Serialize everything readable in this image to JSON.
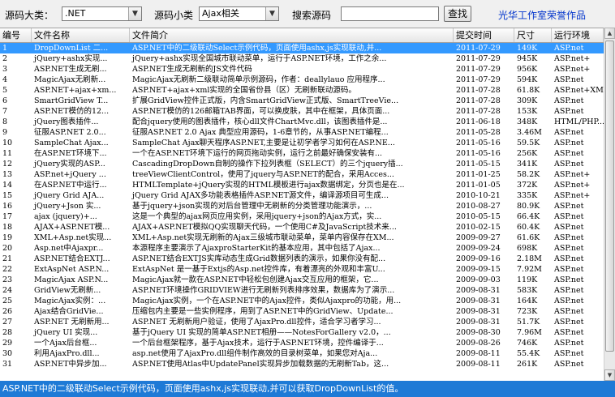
{
  "toolbar": {
    "category_label": "源码大类：",
    "category_value": ".NET",
    "subcategory_label": "源码小类",
    "subcategory_value": "Ajax相关",
    "search_label": "搜索源码",
    "search_value": "",
    "search_button": "查找",
    "credit": "光华工作室荣誉作品"
  },
  "table": {
    "columns": [
      "编号",
      "文件名称",
      "文件简介",
      "提交时间",
      "尺寸",
      "运行环境"
    ],
    "selected_row": 0,
    "rows": [
      [
        "1",
        "DropDownList 二...",
        "ASP.NET中的二级联动Select示例代码，页面使用ashx,js实现联动,并...",
        "2011-07-29",
        "149K",
        "ASP.net"
      ],
      [
        "2",
        "jQuery+ashx实现...",
        "jQuery+ashx实现全国城市联动菜单，运行于ASP.NET环境，工作之余...",
        "2011-07-29",
        "945K",
        "ASP.net+"
      ],
      [
        "3",
        "ASP.NET生成无刷...",
        "ASP.NET生成无刷新的JS文件代码",
        "2011-07-29",
        "956K",
        "ASP.net+"
      ],
      [
        "4",
        "MagicAjax无刷新...",
        "MagicAjax无刷新二级联动简单示例源码，作者：deallylauo 应用程序...",
        "2011-07-29",
        "594K",
        "ASP.net"
      ],
      [
        "5",
        "ASP.NET+ajax+xm...",
        "ASP.NET+ajax+xml实现的全国省份县（区）无刷新联动源码。",
        "2011-07-28",
        "61.8K",
        "ASP.net+XM"
      ],
      [
        "6",
        "SmartGridView T...",
        "扩展GridView控件正式版，内含SmartGridView正式版、SmartTreeVie...",
        "2011-07-28",
        "309K",
        "ASP.net"
      ],
      [
        "7",
        "ASP.NET模仿的12...",
        "ASP.NET模仿的126邮箱TAB界面，可以换皮肤，其中在框架，具体页面...",
        "2011-07-28",
        "153K",
        "ASP.net"
      ],
      [
        "8",
        "jQuery图表插件...",
        "配合jquery使用的图表插件，核心dll文件ChartMvc.dll，该图表插件是...",
        "2011-06-18",
        "348K",
        "HTML/PHP..."
      ],
      [
        "9",
        "征服ASP.NET 2.0...",
        "征服ASP.NET 2.0 Ajax 典型应用源码，1-6章节的，从事ASP.NET编程...",
        "2011-05-28",
        "3.46M",
        "ASP.net"
      ],
      [
        "10",
        "SampleChat Ajax...",
        "SampleChat Ajax聊天程序ASP.NET,主要是让初学者学习如何在ASP.NE...",
        "2011-05-16",
        "59.5K",
        "ASP.net"
      ],
      [
        "11",
        "在ASP.NET环境下...",
        "一个在ASP.NET环境下运行的网页拖动实例，运行之前最好确保安装有...",
        "2011-05-16",
        "256K",
        "ASP.net"
      ],
      [
        "12",
        "jQuery实现的ASP...",
        "CascadingDropDown自制的操作下拉列表框（SELECT）的三个jquery插...",
        "2011-05-15",
        "341K",
        "ASP.net"
      ],
      [
        "13",
        "ASP.net+jQuery ...",
        "treeViewClientControl，使用了jquery与ASP.NET的配合，采用Acces...",
        "2011-01-25",
        "58.2K",
        "ASP.net+"
      ],
      [
        "14",
        "在ASP.NET中运行...",
        "HTMLTemplate+jQuery实现的HTML模板进行ajax数据绑定，分页也是在...",
        "2011-01-05",
        "372K",
        "ASP.net+"
      ],
      [
        "15",
        "jQuery Grid AJA...",
        "jQuery Grid AJAX多功能表格插件ASP.NET源文件，编译源项目可生成...",
        "2010-10-21",
        "335K",
        "ASP.net+"
      ],
      [
        "16",
        "jQuery+Json 实...",
        "基于jquery+json实现的对后台管理中无刷新的分类管理功能演示，...",
        "2010-08-27",
        "80.9K",
        "ASP.net"
      ],
      [
        "17",
        "ajax (jquery)+...",
        "这是一个典型的ajax网页应用实例，采用jquery+json的Ajax方式，实...",
        "2010-05-15",
        "66.4K",
        "ASP.net"
      ],
      [
        "18",
        "AJAX+ASP.NET模...",
        "AJAX+ASP.NET模拟QQ实现聊天代码，一个使用C#及JavaScript技术来...",
        "2010-02-15",
        "60.4K",
        "ASP.net"
      ],
      [
        "19",
        "XML+Asp.net实现...",
        "XML+Asp.net实现无刷新的Ajax三级城市联动菜单，菜单内容保存在XM...",
        "2009-09-27",
        "61.6K",
        "ASP.net"
      ],
      [
        "20",
        "Asp.net中Ajaxpr...",
        "本源程序主要演示了AjaxproStarterKit的基本应用，其中包括了Ajax...",
        "2009-09-24",
        "698K",
        "ASP.net"
      ],
      [
        "21",
        "ASP.NET结合EXTJ...",
        "ASP.NET结合EXTJS实库动态生成Grid数据列表的演示，如果你没有配...",
        "2009-09-16",
        "2.18M",
        "ASP.net"
      ],
      [
        "22",
        "ExtAspNet ASP.N...",
        "ExtAspNet 是一基于Extjs的Asp.net控件库，有着漂亮的外观和丰富U...",
        "2009-09-15",
        "7.92M",
        "ASP.net"
      ],
      [
        "23",
        "MagicAjax ASP.N...",
        "MagicAjax就一款在ASP.NET中轻松包创建Ajax交互应用的框架，它...",
        "2009-09-03",
        "119K",
        "ASP.net"
      ],
      [
        "24",
        "GridView无刷新...",
        "ASP.NET环境操作GRIDVIEW进行无刷新列表排序效果，数据库为了演示...",
        "2009-08-31",
        "583K",
        "ASP.net"
      ],
      [
        "25",
        "MagicAjax实例：...",
        "MagicAjax实例，一个在ASP.NET中的Ajax控件，类似Ajaxpro的功能，用...",
        "2009-08-31",
        "164K",
        "ASP.net"
      ],
      [
        "26",
        "Ajax结合GridVie...",
        "压缩包内主要是一些实例程序，用到了ASP.NET中的GridView、Update...",
        "2009-08-31",
        "723K",
        "ASP.net"
      ],
      [
        "27",
        "ASP.NET 无刷新用...",
        "ASP.NET 无刷新用户验证，使用了AjaxPro.dll控件，适合学习者学习...",
        "2009-08-31",
        "51.7K",
        "ASP.net"
      ],
      [
        "28",
        "jQuery UI 实现...",
        "基于jQuery UI 实现的简单ASP.NET相册——NotesForGallery v2.0，...",
        "2009-08-30",
        "7.96M",
        "ASP.net"
      ],
      [
        "29",
        "一个Ajax后台框...",
        "一个后台框架程序，基于Ajax技术，运行于ASP.NET环境，控件编译于...",
        "2009-08-26",
        "746K",
        "ASP.net"
      ],
      [
        "30",
        "利用AjaxPro.dll...",
        "asp.net使用了AjaxPro.dll组件制作高效的目录树菜单，如果您对Aja...",
        "2009-08-11",
        "55.4K",
        "ASP.net"
      ],
      [
        "31",
        "ASP.NET中异步加...",
        "ASP.NET使用Atlas中UpdatePanel实现异步加载数据的无刷新Tab，这...",
        "2009-08-11",
        "261K",
        "ASP.net"
      ]
    ]
  },
  "status": {
    "text": "ASP.NET中的二级联动Select示例代码，页面使用ashx,js实现联动,并可以获取DropDownList的值。"
  }
}
